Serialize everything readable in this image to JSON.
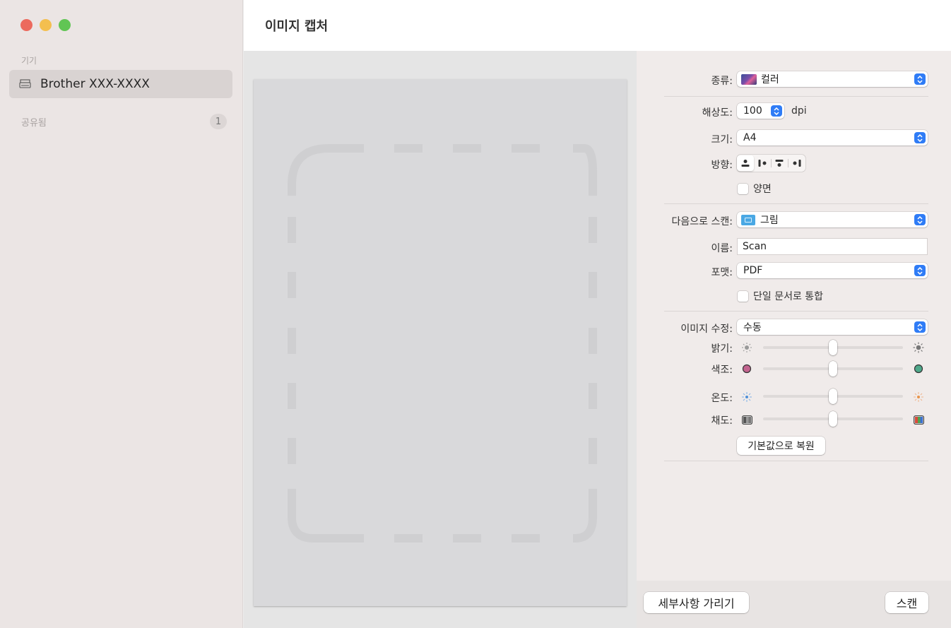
{
  "window": {
    "title": "이미지 캡처"
  },
  "sidebar": {
    "devices_header": "기기",
    "device_name": "Brother XXX-XXXX",
    "shared_header": "공유됨",
    "shared_count": "1"
  },
  "settings": {
    "kind_label": "종류:",
    "kind_value": "컬러",
    "resolution_label": "해상도:",
    "resolution_value": "100",
    "resolution_unit": "dpi",
    "size_label": "크기:",
    "size_value": "A4",
    "orientation_label": "방향:",
    "duplex_label": "양면",
    "scan_to_label": "다음으로 스캔:",
    "scan_to_value": "그림",
    "name_label": "이름:",
    "name_value": "Scan",
    "format_label": "포맷:",
    "format_value": "PDF",
    "combine_label": "단일 문서로 통합",
    "image_correction_label": "이미지 수정:",
    "image_correction_value": "수동",
    "brightness_label": "밝기:",
    "tint_label": "색조:",
    "temperature_label": "온도:",
    "saturation_label": "채도:",
    "restore_defaults": "기본값으로 복원",
    "sliders": {
      "brightness": 0.5,
      "tint": 0.5,
      "temperature": 0.5,
      "saturation": 0.5
    }
  },
  "footer": {
    "hide_details": "세부사항 가리기",
    "scan": "스캔"
  },
  "colors": {
    "accent": "#2f7cf6",
    "close": "#ec6a5e",
    "minimize": "#f4bf4f",
    "zoom": "#61c554"
  }
}
